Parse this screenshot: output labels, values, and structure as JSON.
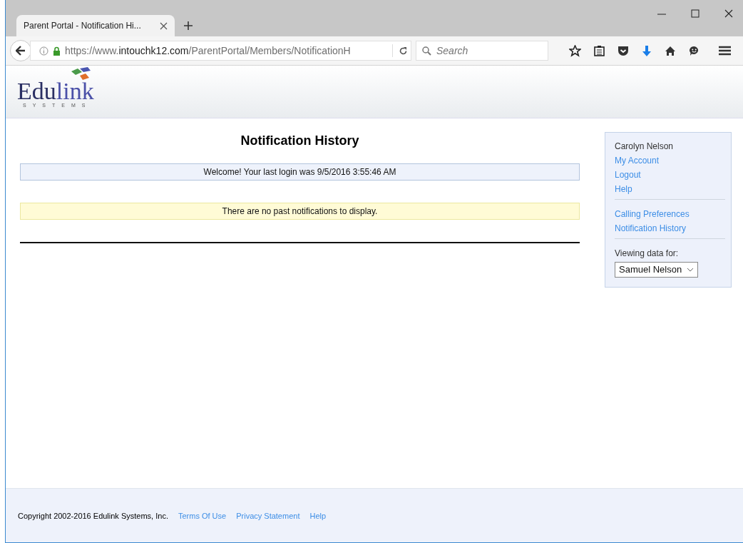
{
  "browser": {
    "tab": {
      "title": "Parent Portal - Notification Hi...",
      "selected": true
    },
    "url": {
      "host_prefix": "https://www.",
      "host": "intouchk12.com",
      "path": "/ParentPortal/Members/NotificationH"
    },
    "search": {
      "placeholder": "Search"
    }
  },
  "header": {
    "logo": {
      "parts": [
        "Edu",
        "link"
      ],
      "tagline": "SYSTEMS"
    }
  },
  "main": {
    "title": "Notification History",
    "welcome": "Welcome! Your last login was 9/5/2016 3:55:46 AM",
    "notice": "There are no past notifications to display."
  },
  "sidebar": {
    "user": "Carolyn Nelson",
    "account_links": [
      "My Account",
      "Logout",
      "Help"
    ],
    "page_links": [
      "Calling Preferences",
      "Notification History"
    ],
    "viewing_label": "Viewing data for:",
    "student": "Samuel Nelson"
  },
  "footer": {
    "copyright": "Copyright 2002-2016 Edulink Systems, Inc.",
    "links": [
      "Terms Of Use",
      "Privacy Statement",
      "Help"
    ]
  }
}
